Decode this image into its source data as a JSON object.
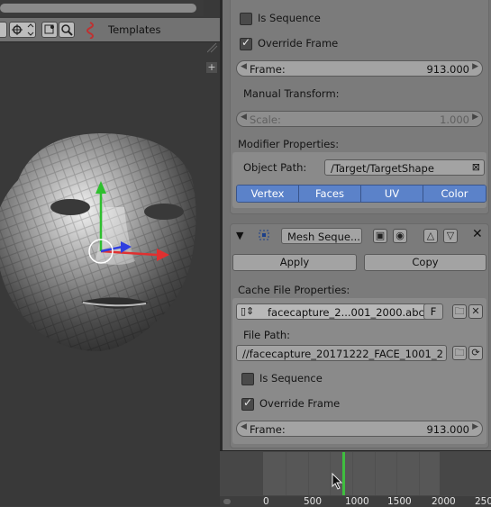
{
  "viewport": {
    "header": {
      "templates_label": "Templates"
    }
  },
  "properties": {
    "top_panel": {
      "is_sequence_label": "Is Sequence",
      "is_sequence_checked": false,
      "override_frame_label": "Override Frame",
      "override_frame_checked": true,
      "frame": {
        "label": "Frame:",
        "value": "913.000"
      },
      "manual_transform_label": "Manual Transform:",
      "scale": {
        "label": "Scale:",
        "value": "1.000"
      },
      "modifier_properties_label": "Modifier Properties:",
      "object_path": {
        "label": "Object Path:",
        "value": "/Target/TargetShape"
      },
      "mode_buttons": [
        "Vertex",
        "Faces",
        "UV",
        "Color"
      ]
    },
    "mesh_sequence_modifier": {
      "name": "Mesh Seque...",
      "apply_label": "Apply",
      "copy_label": "Copy",
      "cache_file_properties_label": "Cache File Properties:",
      "cache_file": {
        "name": "facecapture_2...001_2000.abc",
        "fake_user_label": "F"
      },
      "file_path_label": "File Path:",
      "file_path_value": "//facecapture_20171222_FACE_1001_2...",
      "is_sequence_label": "Is Sequence",
      "is_sequence_checked": false,
      "override_frame_label": "Override Frame",
      "override_frame_checked": true,
      "frame": {
        "label": "Frame:",
        "value": "913.000"
      }
    }
  },
  "timeline": {
    "ticks": [
      "0",
      "500",
      "1000",
      "1500",
      "2000",
      "250"
    ],
    "current_frame": 913
  },
  "colors": {
    "selection_blue": "#5b82c9",
    "axis_x": "#e03030",
    "axis_y": "#2fbf2f",
    "axis_z": "#2f3fe0",
    "playhead": "#3fbd3f"
  }
}
